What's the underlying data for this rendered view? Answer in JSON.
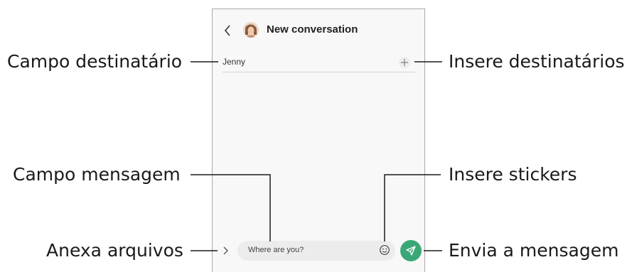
{
  "screen": {
    "header": {
      "title": "New conversation",
      "back_icon": "chevron-left-icon",
      "avatar_icon": "contact-avatar"
    },
    "recipient_field": {
      "value": "Jenny",
      "add_icon": "plus-icon"
    },
    "composer": {
      "attach_icon": "chevron-right-icon",
      "message_placeholder": "Where are you?",
      "sticker_icon": "emoji-icon",
      "send_icon": "send-icon",
      "send_color": "#3aa776"
    }
  },
  "callouts": {
    "recipient_field": "Campo destinatário",
    "add_recipients": "Insere destinatários",
    "message_field": "Campo mensagem",
    "stickers": "Insere stickers",
    "attach_files": "Anexa arquivos",
    "send_message": "Envia a mensagem"
  }
}
